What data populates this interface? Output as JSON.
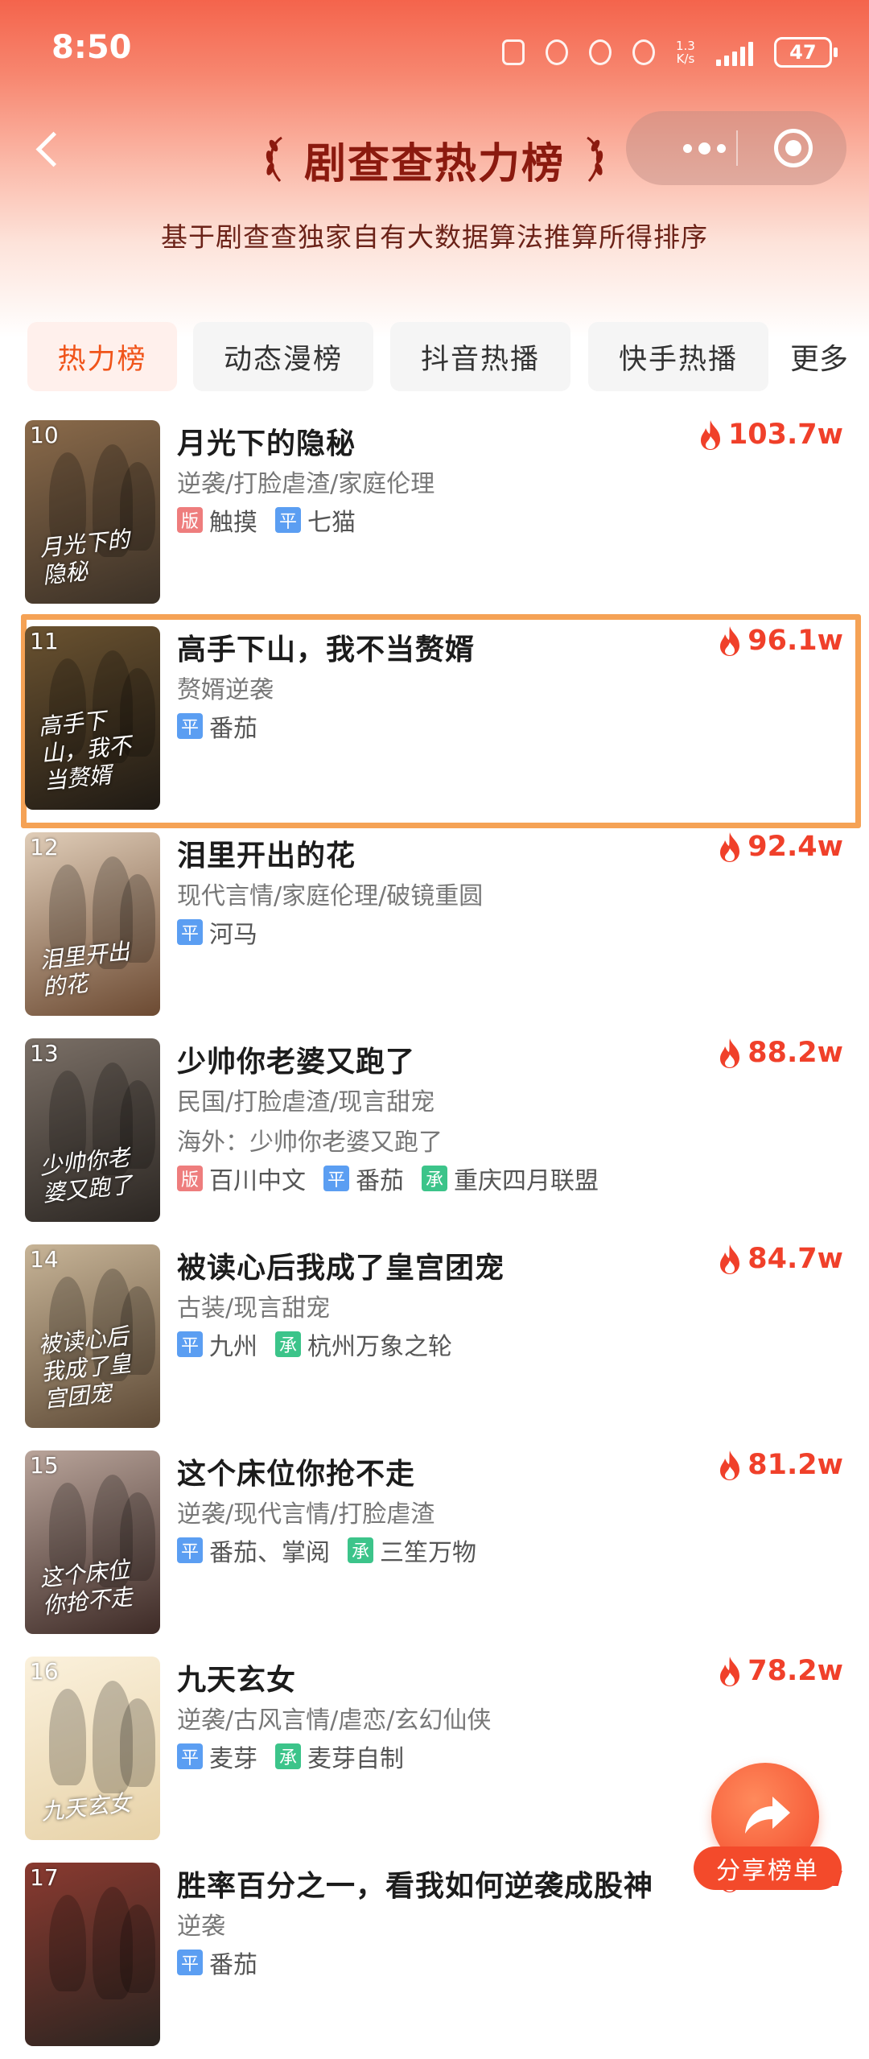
{
  "status_bar": {
    "time": "8:50",
    "net_speed": "1.3\nK/s",
    "battery": "47"
  },
  "header": {
    "title": "剧查查热力榜",
    "subtitle": "基于剧查查独家自有大数据算法推算所得排序"
  },
  "tabs": [
    {
      "label": "热力榜",
      "active": true
    },
    {
      "label": "动态漫榜",
      "active": false
    },
    {
      "label": "抖音热播",
      "active": false
    },
    {
      "label": "快手热播",
      "active": false
    },
    {
      "label": "更多",
      "active": false
    }
  ],
  "badge_colors": {
    "版": "#ee7d7d",
    "平": "#5b9ef2",
    "承": "#3cc48a"
  },
  "accent_color": "#f0402a",
  "items": [
    {
      "rank": "10",
      "title": "月光下的隐秘",
      "genre": "逆袭/打脸虐渣/家庭伦理",
      "heat": "103.7w",
      "poster_title": "月光下的隐秘",
      "tags": [
        {
          "badge": "版",
          "name": "触摸"
        },
        {
          "badge": "平",
          "name": "七猫"
        }
      ]
    },
    {
      "rank": "11",
      "title": "高手下山，我不当赘婿",
      "genre": "赘婿逆袭",
      "heat": "96.1w",
      "poster_title": "高手下山，我不当赘婿",
      "tags": [
        {
          "badge": "平",
          "name": "番茄"
        }
      ]
    },
    {
      "rank": "12",
      "title": "泪里开出的花",
      "genre": "现代言情/家庭伦理/破镜重圆",
      "heat": "92.4w",
      "poster_title": "泪里开出的花",
      "tags": [
        {
          "badge": "平",
          "name": "河马"
        }
      ]
    },
    {
      "rank": "13",
      "title": "少帅你老婆又跑了",
      "genre": "民国/打脸虐渣/现言甜宠",
      "overseas": "海外：少帅你老婆又跑了",
      "heat": "88.2w",
      "poster_title": "少帅你老婆又跑了",
      "tags": [
        {
          "badge": "版",
          "name": "百川中文"
        },
        {
          "badge": "平",
          "name": "番茄"
        },
        {
          "badge": "承",
          "name": "重庆四月联盟"
        }
      ]
    },
    {
      "rank": "14",
      "title": "被读心后我成了皇宫团宠",
      "genre": "古装/现言甜宠",
      "heat": "84.7w",
      "poster_title": "被读心后我成了皇宫团宠",
      "tags": [
        {
          "badge": "平",
          "name": "九州"
        },
        {
          "badge": "承",
          "name": "杭州万象之轮"
        }
      ]
    },
    {
      "rank": "15",
      "title": "这个床位你抢不走",
      "genre": "逆袭/现代言情/打脸虐渣",
      "heat": "81.2w",
      "poster_title": "这个床位你抢不走",
      "tags": [
        {
          "badge": "平",
          "name": "番茄、掌阅"
        },
        {
          "badge": "承",
          "name": "三笙万物"
        }
      ]
    },
    {
      "rank": "16",
      "title": "九天玄女",
      "genre": "逆袭/古风言情/虐恋/玄幻仙侠",
      "heat": "78.2w",
      "poster_title": "九天玄女",
      "tags": [
        {
          "badge": "平",
          "name": "麦芽"
        },
        {
          "badge": "承",
          "name": "麦芽自制"
        }
      ]
    },
    {
      "rank": "17",
      "title": "胜率百分之一，看我如何逆袭成股神",
      "genre": "逆袭",
      "heat": "76.3w",
      "poster_title": "",
      "tags": [
        {
          "badge": "平",
          "name": "番茄"
        }
      ]
    }
  ],
  "share_button": {
    "label": "分享榜单"
  }
}
